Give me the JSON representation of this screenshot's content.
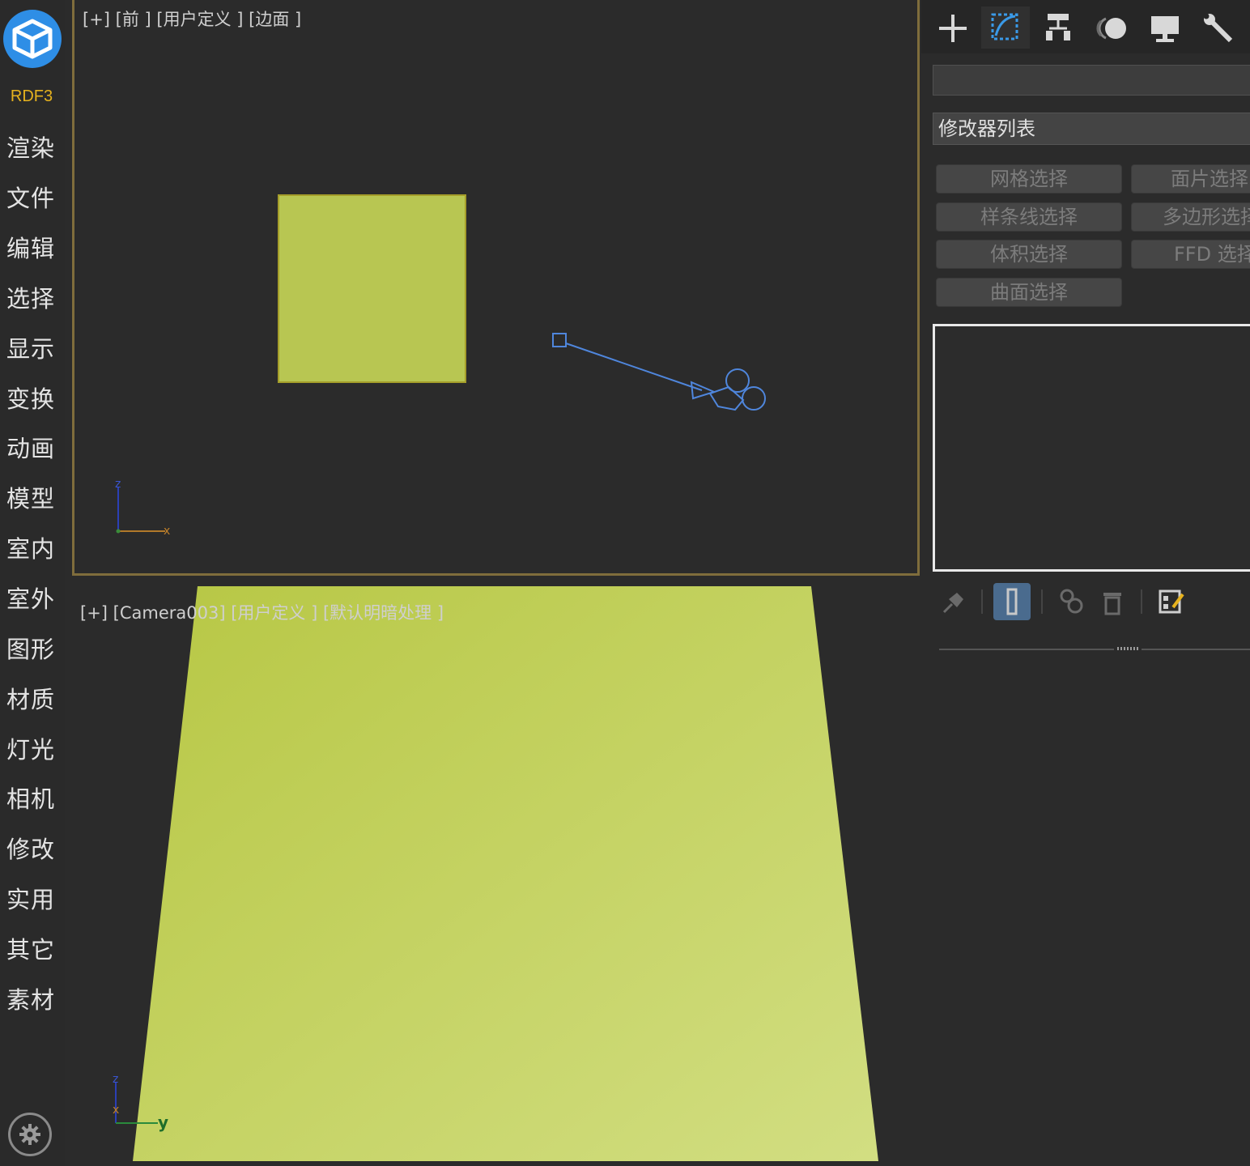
{
  "app": {
    "brand": "RDF3",
    "colors": {
      "accent": "#2e8ee6",
      "brand": "#e6b21e",
      "object": "#b8c652",
      "active_border": "#7f6d3c"
    }
  },
  "sidebar": {
    "items": [
      {
        "label": "渲染"
      },
      {
        "label": "文件"
      },
      {
        "label": "编辑"
      },
      {
        "label": "选择"
      },
      {
        "label": "显示"
      },
      {
        "label": "变换"
      },
      {
        "label": "动画"
      },
      {
        "label": "模型"
      },
      {
        "label": "室内"
      },
      {
        "label": "室外"
      },
      {
        "label": "图形"
      },
      {
        "label": "材质"
      },
      {
        "label": "灯光"
      },
      {
        "label": "相机"
      },
      {
        "label": "修改"
      },
      {
        "label": "实用"
      },
      {
        "label": "其它"
      },
      {
        "label": "素材"
      }
    ],
    "settings_icon": "gear-icon"
  },
  "viewports": {
    "top": {
      "label": "[+] [前 ] [用户定义 ] [边面 ]",
      "axis": {
        "vertical": "z",
        "horizontal": "x"
      }
    },
    "bottom": {
      "label": "[+] [Camera003] [用户定义 ] [默认明暗处理 ]",
      "axis": {
        "vertical": "z",
        "horizontal": "y",
        "origin": "x"
      }
    }
  },
  "command_panel": {
    "tabs": [
      {
        "name": "create",
        "icon": "plus-icon"
      },
      {
        "name": "modify",
        "icon": "modify-icon",
        "active": true
      },
      {
        "name": "hierarchy",
        "icon": "hierarchy-icon"
      },
      {
        "name": "motion",
        "icon": "motion-icon"
      },
      {
        "name": "display",
        "icon": "display-icon"
      },
      {
        "name": "utilities",
        "icon": "wrench-icon"
      }
    ],
    "object_name": "",
    "modifier_list": "修改器列表",
    "modifier_buttons": [
      "网格选择",
      "面片选择",
      "样条线选择",
      "多边形选择",
      "体积选择",
      "FFD 选择",
      "曲面选择"
    ],
    "stack_tools": [
      {
        "icon": "pin-stack-icon"
      },
      {
        "icon": "show-end-result-icon",
        "active": true
      },
      {
        "icon": "make-unique-icon"
      },
      {
        "icon": "remove-modifier-icon"
      },
      {
        "icon": "configure-modifier-sets-icon"
      }
    ]
  }
}
